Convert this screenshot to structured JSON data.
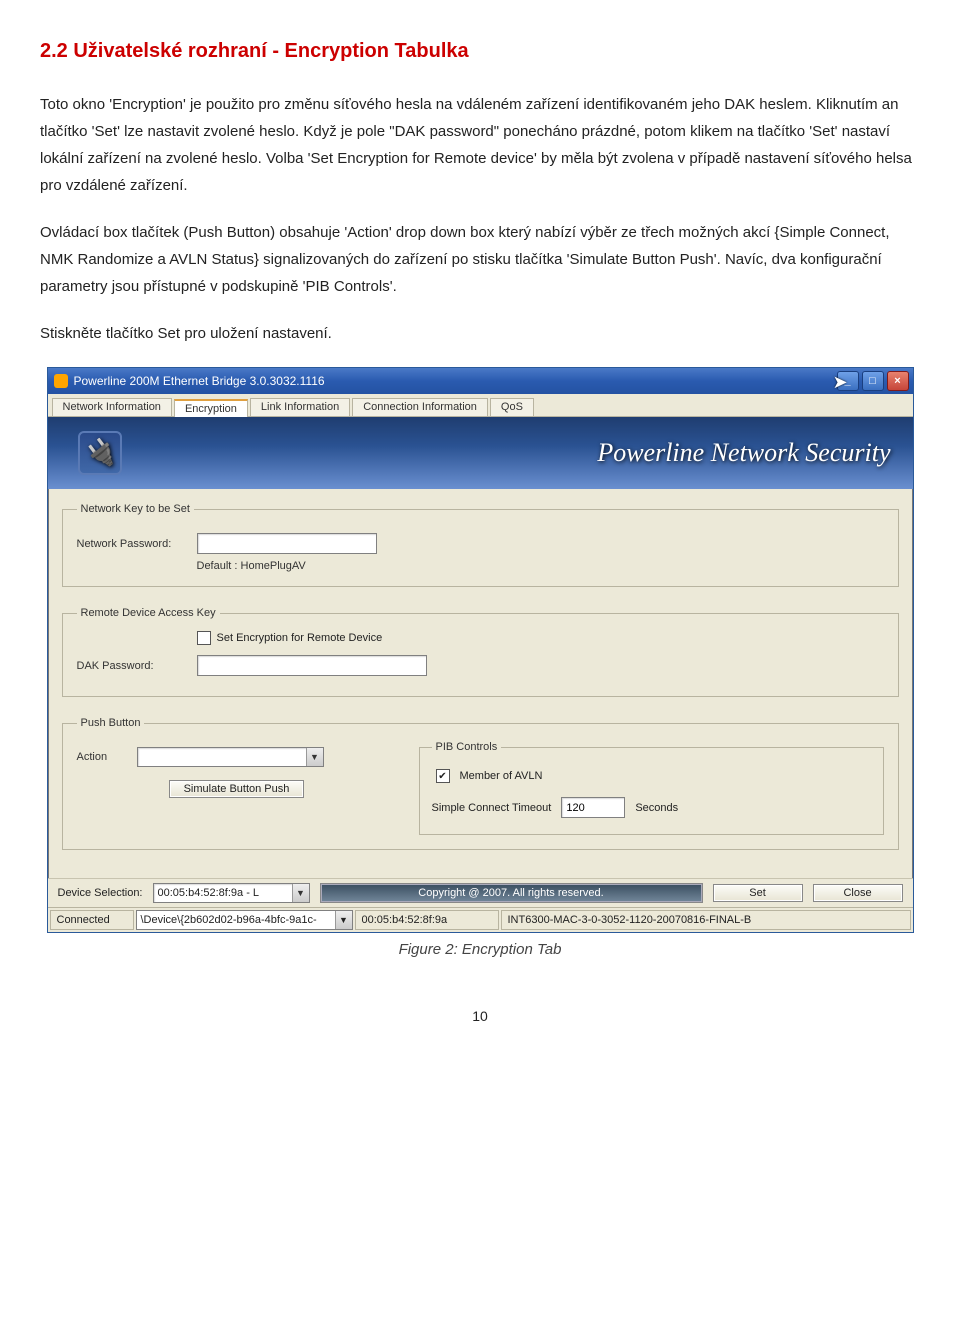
{
  "doc": {
    "heading": "2.2 Uživatelské rozhraní - Encryption Tabulka",
    "para1": "Toto okno 'Encryption' je použito pro změnu síťového hesla na vdáleném zařízení identifikovaném jeho DAK heslem. Kliknutím an tlačítko 'Set' lze nastavit zvolené heslo. Když je pole \"DAK password\" ponecháno prázdné, potom klikem na tlačítko 'Set' nastaví lokální zařízení na zvolené heslo. Volba 'Set Encryption for Remote device' by měla být zvolena v případě nastavení síťového helsa pro vzdálené zařízení.",
    "para2": "Ovládací box tlačítek (Push Button) obsahuje 'Action' drop down box který nabízí výběr ze třech možných akcí {Simple Connect, NMK Randomize a AVLN Status} signalizovaných do zařízení po stisku tlačítka 'Simulate Button Push'. Navíc, dva konfigurační parametry jsou přístupné v podskupině 'PIB Controls'.",
    "para3": "Stiskněte tlačítko Set pro uložení nastavení.",
    "figure_caption": "Figure 2: Encryption Tab",
    "page_number": "10"
  },
  "window": {
    "title": "Powerline 200M Ethernet Bridge 3.0.3032.1116",
    "tabs": {
      "network_info": "Network Information",
      "encryption": "Encryption",
      "link_info": "Link Information",
      "conn_info": "Connection Information",
      "qos": "QoS"
    },
    "banner_text": "Powerline Network Security",
    "group_netkey": {
      "legend": "Network Key to be Set",
      "label_password": "Network Password:",
      "password_value": "",
      "default_hint": "Default : HomePlugAV"
    },
    "group_remote": {
      "legend": "Remote Device Access Key",
      "checkbox_label": "Set Encryption for Remote Device",
      "checkbox_checked": false,
      "label_dak": "DAK Password:",
      "dak_value": ""
    },
    "group_push": {
      "legend": "Push Button",
      "label_action": "Action",
      "action_value": "",
      "btn_simulate": "Simulate Button Push",
      "pib_legend": "PIB Controls",
      "avln_label": "Member of AVLN",
      "avln_checked": true,
      "timeout_label": "Simple Connect Timeout",
      "timeout_value": "120",
      "timeout_unit": "Seconds"
    },
    "footer": {
      "devsel_label": "Device Selection:",
      "devsel_value": "00:05:b4:52:8f:9a - L",
      "copyright": "Copyright @ 2007. All rights reserved.",
      "btn_set": "Set",
      "btn_close": "Close"
    },
    "statusbar": {
      "connected": "Connected",
      "device_path": "\\Device\\{2b602d02-b96a-4bfc-9a1c-",
      "mac": "00:05:b4:52:8f:9a",
      "firmware": "INT6300-MAC-3-0-3052-1120-20070816-FINAL-B"
    }
  }
}
